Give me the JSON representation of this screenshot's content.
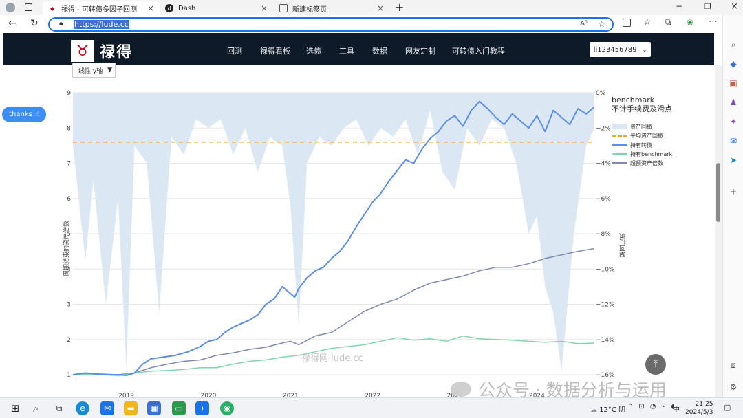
{
  "browser": {
    "tabs": [
      {
        "title": "禄得 - 可转债多因子回测",
        "active": true
      },
      {
        "title": "Dash",
        "active": false
      },
      {
        "title": "新建标签页",
        "active": false
      }
    ],
    "url": "https://lude.cc",
    "reader_icon": "A⁵"
  },
  "site": {
    "logo_text": "禄得",
    "nav": [
      "回测",
      "禄得看板",
      "选债",
      "工具",
      "数据",
      "网友定制",
      "可转债入门教程"
    ],
    "user_label": "li123456789",
    "thanks_label": "thanks",
    "yscale_label": "线性 y轴",
    "watermark": "禄得网 lude.cc",
    "wechat_watermark": "公众号 · 数据分析与运用"
  },
  "chart_data": {
    "type": "line",
    "legend_title": "benchmark",
    "legend_subtitle": "不计手续费及滑点",
    "xlabel": "",
    "ylabel_left": "周期结束的资产倍数",
    "ylabel_right": "资产回撤",
    "x_ticks": [
      "2019",
      "2020",
      "2021",
      "2022",
      "2023",
      "2024"
    ],
    "x_range": [
      2018.35,
      2024.7
    ],
    "y_left_range": [
      1,
      9
    ],
    "y_left_ticks": [
      "1",
      "2",
      "3",
      "4",
      "5",
      "6",
      "7",
      "8",
      "9"
    ],
    "y_right_range": [
      -16,
      0
    ],
    "y_right_ticks": [
      "0%",
      "-2%",
      "-4%",
      "-6%",
      "-8%",
      "-10%",
      "-12%",
      "-14%",
      "-16%"
    ],
    "grid": true,
    "legend_position": "right",
    "avg_drawdown": -2.8,
    "series": [
      {
        "name": "资产回撤",
        "axis": "right",
        "color": "#dbe8f4",
        "type": "area",
        "x": [
          2018.35,
          2018.5,
          2018.6,
          2018.75,
          2018.9,
          2019.0,
          2019.1,
          2019.25,
          2019.4,
          2019.55,
          2019.7,
          2019.85,
          2020.0,
          2020.15,
          2020.3,
          2020.45,
          2020.6,
          2020.75,
          2020.9,
          2021.0,
          2021.1,
          2021.2,
          2021.35,
          2021.5,
          2021.65,
          2021.8,
          2021.95,
          2022.1,
          2022.25,
          2022.4,
          2022.55,
          2022.7,
          2022.85,
          2023.0,
          2023.15,
          2023.3,
          2023.45,
          2023.6,
          2023.75,
          2023.9,
          2024.0,
          2024.1,
          2024.2,
          2024.3,
          2024.45,
          2024.6,
          2024.7
        ],
        "values": [
          -3.0,
          -9.5,
          -5.0,
          -12.0,
          -6.0,
          -15.6,
          -3.0,
          -4.0,
          -12.5,
          -2.5,
          -3.5,
          -1.5,
          -2.0,
          -1.5,
          -3.5,
          -2.0,
          -4.5,
          -2.5,
          -3.0,
          -6.5,
          -13.2,
          -4.0,
          -2.5,
          -3.0,
          -2.0,
          -1.5,
          -3.0,
          -2.0,
          -2.5,
          -1.5,
          -3.5,
          -1.0,
          -4.5,
          -5.5,
          -2.0,
          -3.0,
          -1.5,
          -2.0,
          -4.0,
          -8.0,
          -7.0,
          -11.0,
          -12.5,
          -15.8,
          -8.0,
          -3.0,
          -2.0
        ]
      },
      {
        "name": "平均资产回撤",
        "axis": "right",
        "color": "#f5a623",
        "type": "dash"
      },
      {
        "name": "持有转债",
        "axis": "left",
        "color": "#5a8de8",
        "x": [
          2018.35,
          2018.5,
          2018.7,
          2018.9,
          2019.0,
          2019.1,
          2019.2,
          2019.3,
          2019.45,
          2019.6,
          2019.75,
          2019.9,
          2020.0,
          2020.1,
          2020.2,
          2020.3,
          2020.4,
          2020.5,
          2020.6,
          2020.7,
          2020.8,
          2020.9,
          2021.0,
          2021.05,
          2021.1,
          2021.2,
          2021.3,
          2021.4,
          2021.5,
          2021.6,
          2021.7,
          2021.8,
          2021.9,
          2022.0,
          2022.1,
          2022.2,
          2022.3,
          2022.4,
          2022.5,
          2022.6,
          2022.7,
          2022.8,
          2022.9,
          2023.0,
          2023.1,
          2023.2,
          2023.3,
          2023.4,
          2023.5,
          2023.6,
          2023.7,
          2023.8,
          2023.9,
          2024.0,
          2024.1,
          2024.2,
          2024.3,
          2024.4,
          2024.5,
          2024.6,
          2024.7
        ],
        "values": [
          1.0,
          1.05,
          1.0,
          1.0,
          0.98,
          1.05,
          1.3,
          1.45,
          1.5,
          1.55,
          1.65,
          1.8,
          1.95,
          2.0,
          2.2,
          2.35,
          2.45,
          2.55,
          2.7,
          3.0,
          3.15,
          3.5,
          3.3,
          3.2,
          3.45,
          3.75,
          3.95,
          4.05,
          4.3,
          4.5,
          4.8,
          5.2,
          5.55,
          5.9,
          6.15,
          6.5,
          6.8,
          7.1,
          7.0,
          7.4,
          7.7,
          7.9,
          8.2,
          8.35,
          8.05,
          8.5,
          8.75,
          8.55,
          8.3,
          8.1,
          8.4,
          8.2,
          8.0,
          8.35,
          7.9,
          8.5,
          8.3,
          8.1,
          8.55,
          8.4,
          8.6
        ]
      },
      {
        "name": "持有benchmark",
        "axis": "left",
        "color": "#7fd4ae",
        "x": [
          2018.35,
          2018.6,
          2018.9,
          2019.1,
          2019.3,
          2019.5,
          2019.7,
          2019.9,
          2020.1,
          2020.3,
          2020.5,
          2020.7,
          2020.9,
          2021.1,
          2021.3,
          2021.5,
          2021.7,
          2021.9,
          2022.1,
          2022.3,
          2022.5,
          2022.7,
          2022.9,
          2023.1,
          2023.3,
          2023.5,
          2023.7,
          2023.9,
          2024.1,
          2024.3,
          2024.5,
          2024.7
        ],
        "values": [
          1.0,
          1.02,
          0.97,
          1.05,
          1.1,
          1.12,
          1.15,
          1.2,
          1.2,
          1.3,
          1.38,
          1.42,
          1.5,
          1.55,
          1.65,
          1.75,
          1.8,
          1.85,
          1.95,
          2.05,
          1.98,
          2.02,
          1.95,
          2.1,
          2.02,
          2.0,
          1.98,
          1.95,
          1.92,
          1.95,
          1.88,
          1.9
        ]
      },
      {
        "name": "超额资产倍数",
        "axis": "left",
        "color": "#7f8ab0",
        "x": [
          2018.35,
          2018.6,
          2018.9,
          2019.1,
          2019.3,
          2019.5,
          2019.7,
          2019.9,
          2020.1,
          2020.3,
          2020.5,
          2020.7,
          2020.9,
          2021.0,
          2021.1,
          2021.3,
          2021.5,
          2021.7,
          2021.9,
          2022.1,
          2022.3,
          2022.5,
          2022.7,
          2022.9,
          2023.1,
          2023.3,
          2023.5,
          2023.7,
          2023.9,
          2024.1,
          2024.3,
          2024.5,
          2024.7
        ],
        "values": [
          1.0,
          1.03,
          1.0,
          1.05,
          1.2,
          1.3,
          1.38,
          1.42,
          1.55,
          1.62,
          1.72,
          1.78,
          1.9,
          1.95,
          1.85,
          2.1,
          2.2,
          2.5,
          2.8,
          3.0,
          3.15,
          3.4,
          3.6,
          3.7,
          3.8,
          3.95,
          4.05,
          4.05,
          4.15,
          4.3,
          4.4,
          4.5,
          4.58
        ]
      }
    ]
  },
  "taskbar": {
    "weather": "12°C 阴",
    "ime": "中",
    "time": "21:25",
    "date": "2024/5/3"
  }
}
